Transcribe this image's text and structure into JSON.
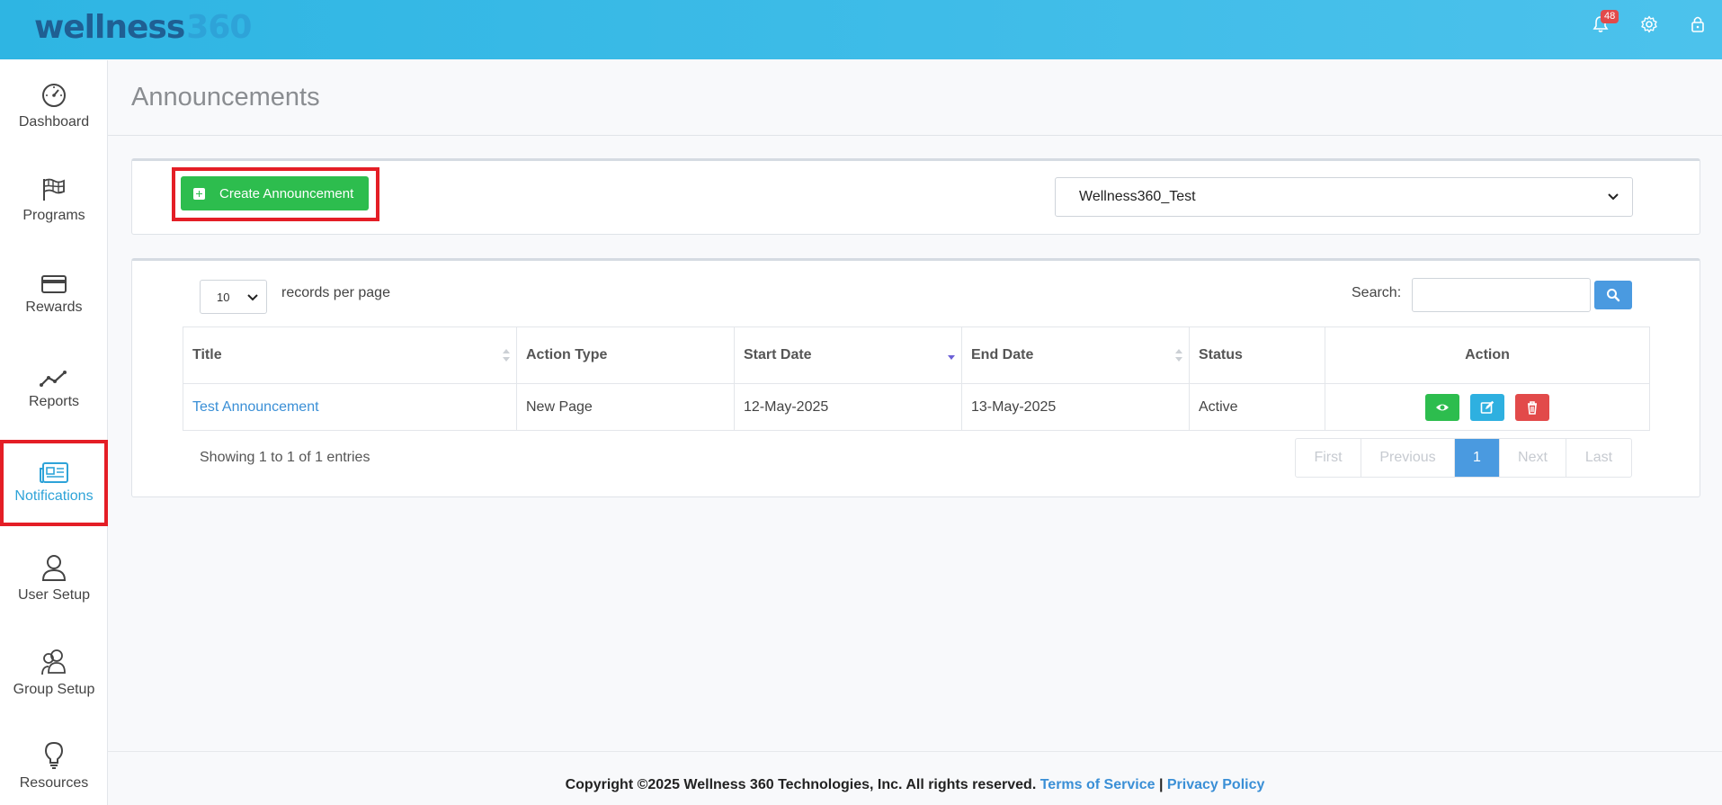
{
  "brand": {
    "name": "wellness",
    "num": "360"
  },
  "header": {
    "notification_count": "48"
  },
  "sidebar": {
    "items": [
      {
        "label": "Dashboard"
      },
      {
        "label": "Programs"
      },
      {
        "label": "Rewards"
      },
      {
        "label": "Reports"
      },
      {
        "label": "Notifications"
      },
      {
        "label": "User Setup"
      },
      {
        "label": "Group Setup"
      },
      {
        "label": "Resources"
      }
    ]
  },
  "page": {
    "title": "Announcements"
  },
  "toolbar": {
    "create_label": "Create Announcement",
    "org_selected": "Wellness360_Test"
  },
  "table_controls": {
    "per_page_value": "10",
    "per_page_label": "records per page",
    "search_label": "Search:"
  },
  "table": {
    "headers": [
      "Title",
      "Action Type",
      "Start Date",
      "End Date",
      "Status",
      "Action"
    ],
    "rows": [
      {
        "title": "Test Announcement",
        "action_type": "New Page",
        "start_date": "12-May-2025",
        "end_date": "13-May-2025",
        "status": "Active"
      }
    ]
  },
  "summary": {
    "showing": "Showing 1 to 1 of 1 entries"
  },
  "pagination": {
    "first": "First",
    "previous": "Previous",
    "current": "1",
    "next": "Next",
    "last": "Last"
  },
  "footer": {
    "copyright": "Copyright ©2025 Wellness 360 Technologies, Inc. All rights reserved.",
    "terms": "Terms of Service",
    "separator": "|",
    "privacy": "Privacy Policy"
  },
  "colors": {
    "header": "#2eb5e3",
    "accent": "#2ea3d8",
    "create": "#2dbd4e",
    "view": "#2dbd4e",
    "edit": "#2eb0e0",
    "delete": "#e24a4a",
    "highlight": "#e41e26"
  }
}
